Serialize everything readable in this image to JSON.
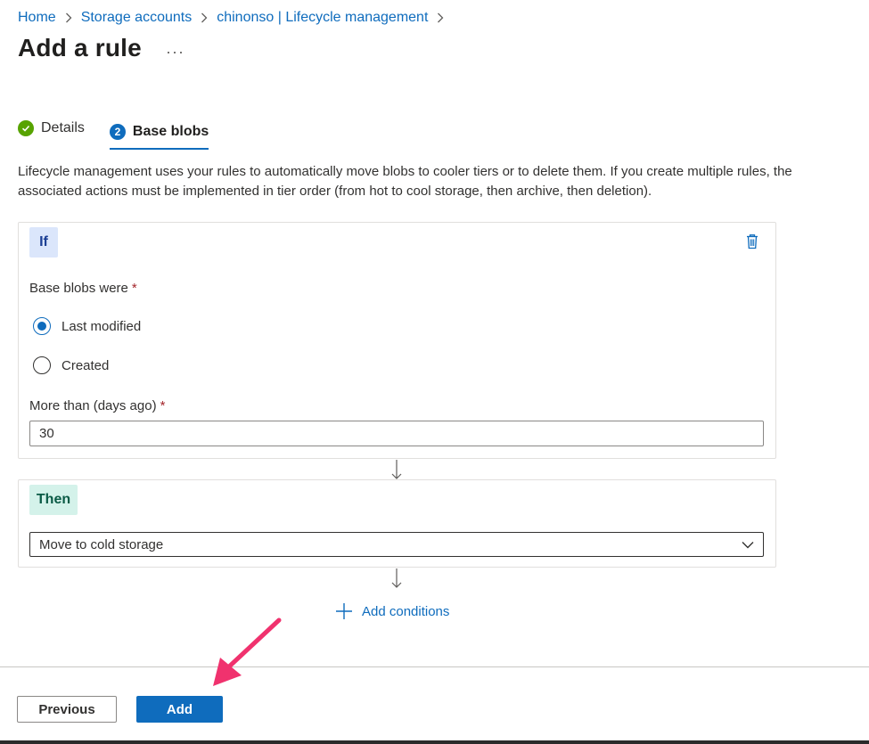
{
  "breadcrumb": {
    "items": [
      "Home",
      "Storage accounts",
      "chinonso | Lifecycle management"
    ]
  },
  "page": {
    "title": "Add a rule",
    "more": "···"
  },
  "steps": [
    {
      "label": "Details",
      "state": "complete"
    },
    {
      "label": "Base blobs",
      "number": "2",
      "state": "active"
    }
  ],
  "description": "Lifecycle management uses your rules to automatically move blobs to cooler tiers or to delete them. If you create multiple rules, the associated actions must be implemented in tier order (from hot to cool storage, then archive, then deletion).",
  "if_block": {
    "tag": "If",
    "base_blobs_label": "Base blobs were",
    "required_mark": "*",
    "options": [
      "Last modified",
      "Created"
    ],
    "selected_option": "Last modified",
    "days_label": "More than (days ago)",
    "days_value": "30"
  },
  "then_block": {
    "tag": "Then",
    "action_value": "Move to cold storage"
  },
  "add_conditions_label": "Add conditions",
  "footer": {
    "previous_label": "Previous",
    "add_label": "Add"
  },
  "colors": {
    "accent": "#0f6cbd",
    "success": "#57a300",
    "if_tag_bg": "#dbe6fb",
    "then_tag_bg": "#d4f2ea",
    "annotation_arrow": "#f0326e"
  },
  "icons": [
    "chevron-right-icon",
    "check-circle-icon",
    "delete-icon",
    "chevron-down-icon",
    "arrow-down-icon",
    "plus-icon"
  ]
}
